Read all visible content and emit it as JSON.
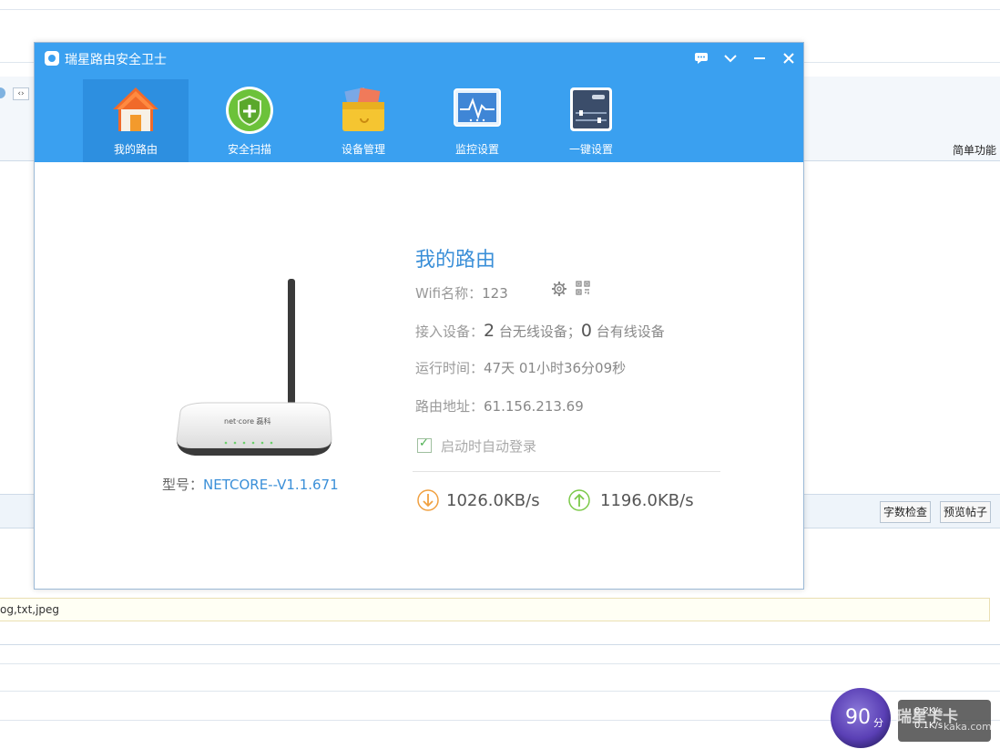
{
  "background": {
    "simple_function": "简单功能",
    "word_count_button": "字数检查",
    "preview_button": "预览帖子",
    "file_types": "og,txt,jpeg"
  },
  "dialog": {
    "title": "瑞星路由安全卫士",
    "tabs": [
      {
        "label": "我的路由",
        "icon": "home-icon",
        "active": true
      },
      {
        "label": "安全扫描",
        "icon": "shield-plus-icon",
        "active": false
      },
      {
        "label": "设备管理",
        "icon": "toolbox-icon",
        "active": false
      },
      {
        "label": "监控设置",
        "icon": "monitor-icon",
        "active": false
      },
      {
        "label": "一键设置",
        "icon": "router-settings-icon",
        "active": false
      }
    ],
    "content": {
      "heading": "我的路由",
      "wifi_label": "Wifi名称：",
      "wifi_value": "123",
      "devices_label": "接入设备：",
      "wireless_count": "2",
      "wireless_text": "台无线设备；",
      "wired_count": "0",
      "wired_text": "台有线设备",
      "uptime_label": "运行时间：",
      "uptime_value": "47天 01小时36分09秒",
      "address_label": "路由地址：",
      "address_value": "61.156.213.69",
      "autologin_label": "启动时自动登录",
      "autologin_checked": true,
      "model_label": "型号：",
      "model_value": "NETCORE--V1.1.671",
      "router_brand": "net·core 磊科",
      "download_speed": "1026.0KB/s",
      "upload_speed": "1196.0KB/s"
    }
  },
  "widget": {
    "score": "90",
    "score_unit": "分",
    "net_up": "0.2K/s",
    "net_down": "0.1K/s",
    "watermark": "瑞星卡卡",
    "watermark_domain": "kaka.com"
  },
  "colors": {
    "header_blue": "#3aa0f0",
    "active_tab": "#2d8fe0",
    "accent_text": "#3a8fd8",
    "download_orange": "#f0a040",
    "upload_green": "#7cc94a"
  }
}
